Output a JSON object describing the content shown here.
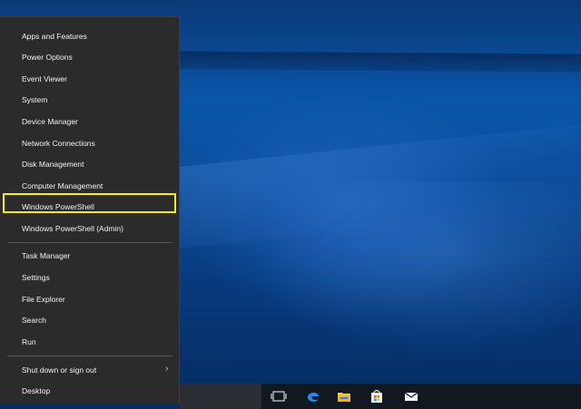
{
  "menu": {
    "group1": [
      "Apps and Features",
      "Power Options",
      "Event Viewer",
      "System",
      "Device Manager",
      "Network Connections",
      "Disk Management",
      "Computer Management",
      "Windows PowerShell",
      "Windows PowerShell (Admin)"
    ],
    "group2": [
      "Task Manager",
      "Settings",
      "File Explorer",
      "Search",
      "Run"
    ],
    "group3": [
      "Shut down or sign out",
      "Desktop"
    ],
    "highlighted_item": "Computer Management",
    "highlight_color": "#f6eb17"
  },
  "taskbar": {
    "icons": [
      "task-view-icon",
      "edge-icon",
      "file-explorer-icon",
      "store-icon",
      "mail-icon"
    ],
    "accent": "#0078d7"
  }
}
